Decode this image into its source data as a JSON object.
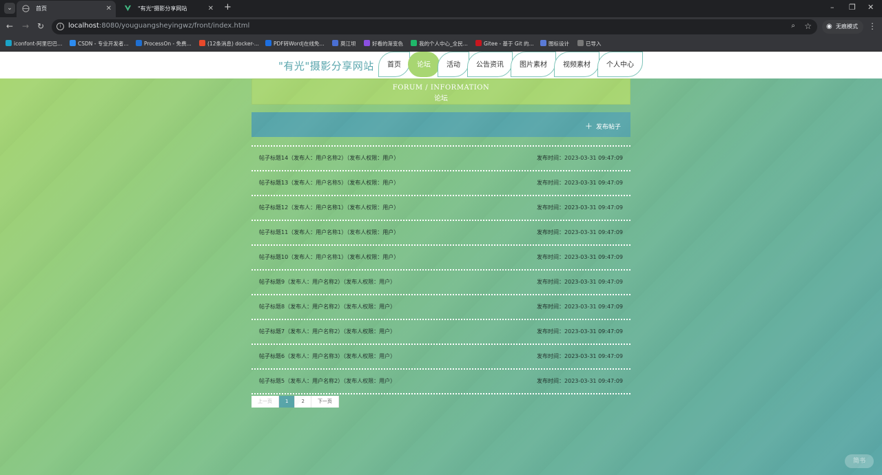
{
  "browser": {
    "tabs": [
      {
        "title": "首页",
        "active": true
      },
      {
        "title": "\"有光\"摄影分享网站",
        "active": false
      }
    ],
    "url_host": "localhost",
    "url_rest": ":8080/youguangsheyingwz/front/index.html",
    "incognito_label": "无痕模式",
    "bookmarks": [
      {
        "label": "iconfont-阿里巴巴...",
        "color": "#1aa3c7"
      },
      {
        "label": "CSDN - 专业开发者...",
        "color": "#2d8cf0"
      },
      {
        "label": "ProcessOn - 免费...",
        "color": "#1f6fd1"
      },
      {
        "label": "(12条消息) docker-...",
        "color": "#e8492b"
      },
      {
        "label": "PDF转Word|在线免...",
        "color": "#1d6fe0"
      },
      {
        "label": "莫江坝",
        "color": "#4a6fd3"
      },
      {
        "label": "好看的渐变色",
        "color": "#8a4fe0"
      },
      {
        "label": "我的个人中心_全民...",
        "color": "#1fb86a"
      },
      {
        "label": "Gitee - 基于 Git 的...",
        "color": "#c7161e"
      },
      {
        "label": "图标设计",
        "color": "#5a7bd8"
      },
      {
        "label": "已导入",
        "color": "#777777"
      }
    ]
  },
  "site": {
    "title": "\"有光\"摄影分享网站",
    "menu": [
      "首页",
      "论坛",
      "活动",
      "公告资讯",
      "图片素材",
      "视频素材",
      "个人中心"
    ],
    "active_menu": "论坛"
  },
  "banner": {
    "en": "FORUM / INFORMATION",
    "cn": "论坛"
  },
  "actions": {
    "post_button": "发布帖子"
  },
  "posts": [
    {
      "title": "帖子标题14（发布人：用户名称2）（发布人权限：用户）",
      "time": "发布时间：2023-03-31 09:47:09"
    },
    {
      "title": "帖子标题13（发布人：用户名称5）（发布人权限：用户）",
      "time": "发布时间：2023-03-31 09:47:09"
    },
    {
      "title": "帖子标题12（发布人：用户名称1）（发布人权限：用户）",
      "time": "发布时间：2023-03-31 09:47:09"
    },
    {
      "title": "帖子标题11（发布人：用户名称1）（发布人权限：用户）",
      "time": "发布时间：2023-03-31 09:47:09"
    },
    {
      "title": "帖子标题10（发布人：用户名称1）（发布人权限：用户）",
      "time": "发布时间：2023-03-31 09:47:09"
    },
    {
      "title": "帖子标题9（发布人：用户名称2）（发布人权限：用户）",
      "time": "发布时间：2023-03-31 09:47:09"
    },
    {
      "title": "帖子标题8（发布人：用户名称2）（发布人权限：用户）",
      "time": "发布时间：2023-03-31 09:47:09"
    },
    {
      "title": "帖子标题7（发布人：用户名称2）（发布人权限：用户）",
      "time": "发布时间：2023-03-31 09:47:09"
    },
    {
      "title": "帖子标题6（发布人：用户名称3）（发布人权限：用户）",
      "time": "发布时间：2023-03-31 09:47:09"
    },
    {
      "title": "帖子标题5（发布人：用户名称2）（发布人权限：用户）",
      "time": "发布时间：2023-03-31 09:47:09"
    }
  ],
  "pager": {
    "prev": "上一页",
    "pages": [
      "1",
      "2"
    ],
    "current": "1",
    "next": "下一页"
  },
  "watermark": "简书"
}
